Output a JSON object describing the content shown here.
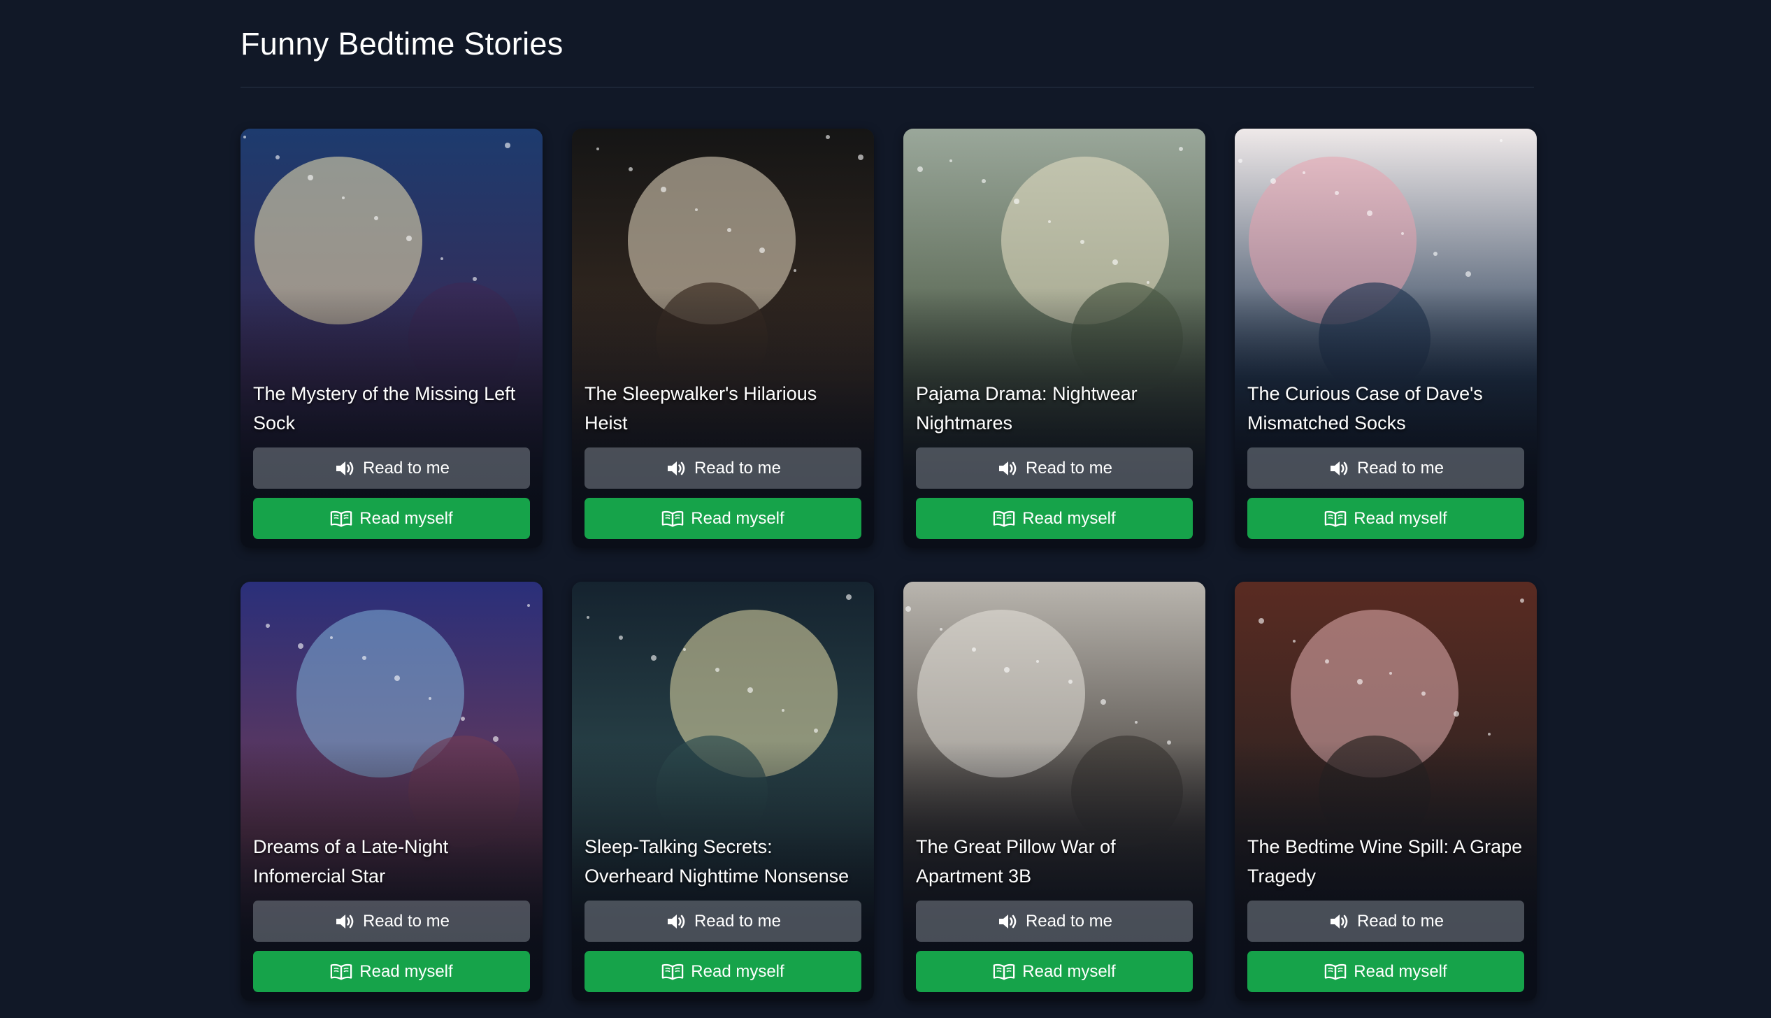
{
  "page": {
    "title": "Funny Bedtime Stories"
  },
  "buttons": {
    "read_to_me_label": "Read to me",
    "read_myself_label": "Read myself",
    "read_to_me_icon": "speaker-icon",
    "read_myself_icon": "open-book-icon"
  },
  "colors": {
    "page_background": "#111827",
    "read_myself_button": "#16a34a",
    "read_to_me_button": "#6e747e"
  },
  "stories": [
    {
      "title": "The Mystery of the Missing Left Sock",
      "theme": [
        "#1d3b6e",
        "#f3e6b0",
        "#3b2a55"
      ]
    },
    {
      "title": "The Sleepwalker's Hilarious Heist",
      "theme": [
        "#151515",
        "#e9dcc4",
        "#3a2c22"
      ]
    },
    {
      "title": "Pajama Drama: Nightwear Nightmares",
      "theme": [
        "#9aa79a",
        "#e9e2c7",
        "#4d5b46"
      ]
    },
    {
      "title": "The Curious Case of Dave's Mismatched Socks",
      "theme": [
        "#efe9e9",
        "#e7a3ae",
        "#263b55"
      ]
    },
    {
      "title": "Dreams of a Late-Night Infomercial Star",
      "theme": [
        "#2a2f7a",
        "#7fb3d9",
        "#6c3a56"
      ]
    },
    {
      "title": "Sleep-Talking Secrets: Overheard Nighttime Nonsense",
      "theme": [
        "#15232f",
        "#e6dca7",
        "#2e4b4f"
      ]
    },
    {
      "title": "The Great Pillow War of Apartment 3B",
      "theme": [
        "#b9b5ae",
        "#e8e4dd",
        "#3f3a36"
      ]
    },
    {
      "title": "The Bedtime Wine Spill: A Grape Tragedy",
      "theme": [
        "#5a2b22",
        "#e3b0b3",
        "#2b2322"
      ]
    }
  ]
}
